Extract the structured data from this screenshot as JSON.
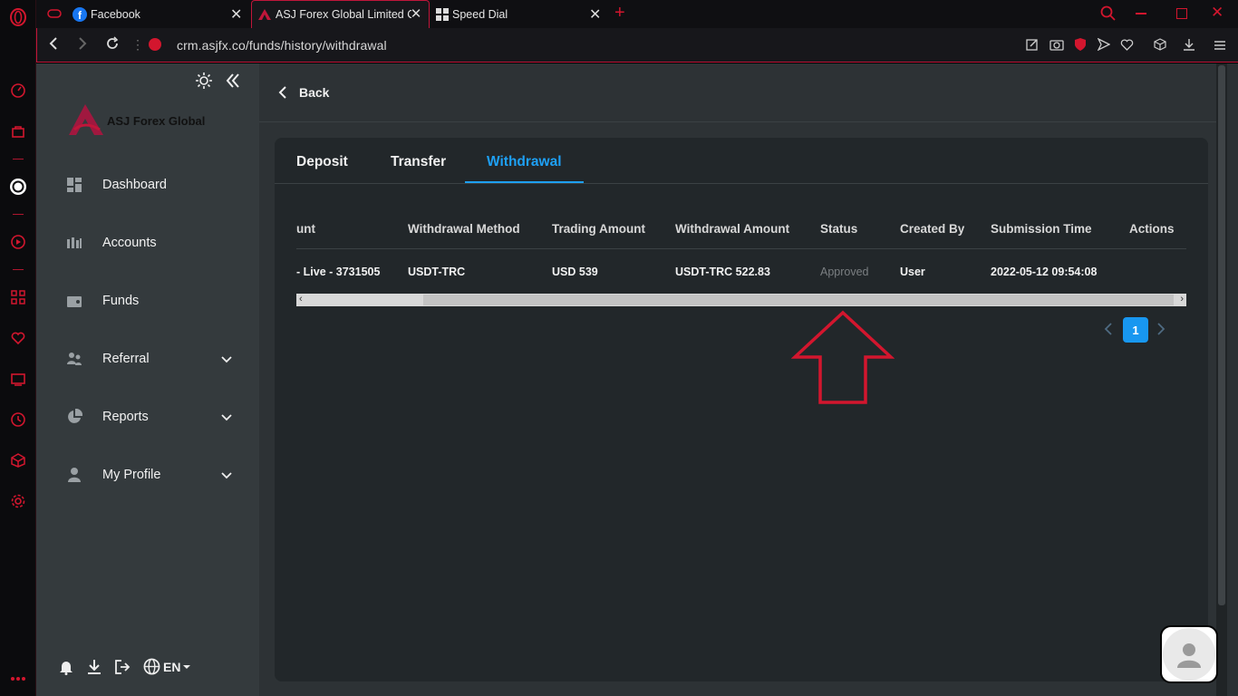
{
  "browser": {
    "tabs": [
      {
        "title": "Facebook"
      },
      {
        "title": "ASJ Forex Global Limited CRM"
      },
      {
        "title": "Speed Dial"
      }
    ],
    "url": "crm.asjfx.co/funds/history/withdrawal"
  },
  "sidebar": {
    "brand": "ASJ Forex Global",
    "items": [
      {
        "label": "Dashboard"
      },
      {
        "label": "Accounts"
      },
      {
        "label": "Funds"
      },
      {
        "label": "Referral"
      },
      {
        "label": "Reports"
      },
      {
        "label": "My Profile"
      }
    ],
    "language": "EN"
  },
  "header": {
    "back_label": "Back"
  },
  "tabs": {
    "deposit": "Deposit",
    "transfer": "Transfer",
    "withdrawal": "Withdrawal",
    "active": "withdrawal"
  },
  "table": {
    "columns": [
      "unt",
      "Withdrawal Method",
      "Trading Amount",
      "Withdrawal Amount",
      "Status",
      "Created By",
      "Submission Time",
      "Actions"
    ],
    "rows": [
      {
        "account": "- Live - 3731505",
        "method": "USDT-TRC",
        "trading_amount": "USD 539",
        "withdrawal_amount": "USDT-TRC 522.83",
        "status": "Approved",
        "created_by": "User",
        "submission_time": "2022-05-12 09:54:08"
      }
    ]
  },
  "pagination": {
    "current": "1"
  },
  "colors": {
    "accent": "#1897f0",
    "brand": "#c0163a",
    "annotation_arrow": "#d3162e"
  }
}
